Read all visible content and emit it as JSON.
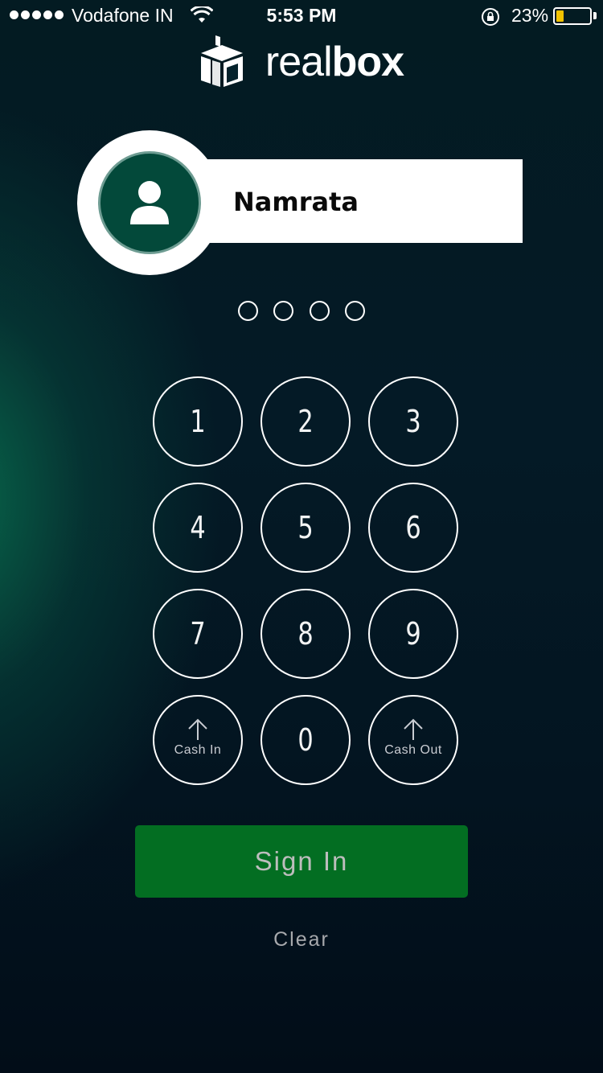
{
  "status_bar": {
    "carrier": "Vodafone IN",
    "time": "5:53 PM",
    "battery_percent": "23%",
    "battery_level": 0.23,
    "signal_bars": 5,
    "icons": [
      "wifi-icon",
      "orientation-lock-icon",
      "battery-icon"
    ],
    "battery_color": "#f2c200"
  },
  "logo": {
    "text_light": "real",
    "text_bold": "box",
    "icon": "realbox-logo-icon"
  },
  "user": {
    "name": "Namrata",
    "avatar_icon": "person-icon",
    "avatar_color": "#03493a"
  },
  "pin": {
    "length": 4,
    "entered": 0
  },
  "keypad": {
    "keys": [
      {
        "digit": "1"
      },
      {
        "digit": "2"
      },
      {
        "digit": "3"
      },
      {
        "digit": "4"
      },
      {
        "digit": "5"
      },
      {
        "digit": "6"
      },
      {
        "digit": "7"
      },
      {
        "digit": "8"
      },
      {
        "digit": "9"
      },
      {
        "label": "Cash In",
        "icon": "arrow-up-icon"
      },
      {
        "digit": "0"
      },
      {
        "label": "Cash Out",
        "icon": "arrow-up-icon"
      }
    ]
  },
  "actions": {
    "sign_in_label": "Sign In",
    "clear_label": "Clear",
    "sign_in_color": "#036e22"
  }
}
